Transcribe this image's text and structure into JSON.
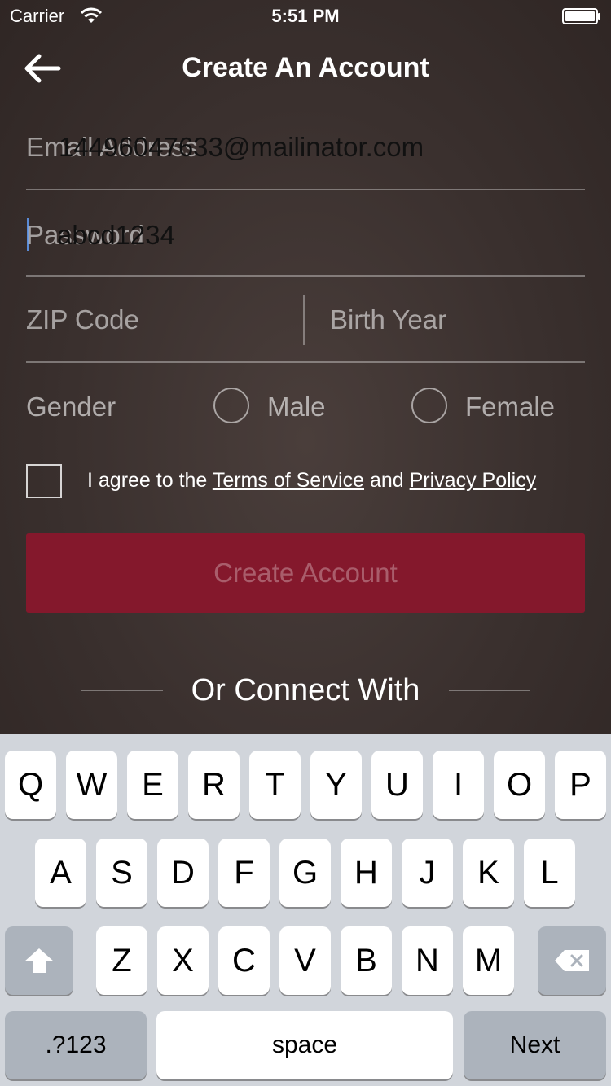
{
  "status_bar": {
    "carrier": "Carrier",
    "time": "5:51 PM"
  },
  "nav": {
    "title": "Create An Account"
  },
  "form": {
    "email": {
      "placeholder": "Email Address",
      "value": "14496047633@mailinator.com"
    },
    "password": {
      "placeholder": "Password",
      "value": "abcd1234"
    },
    "zip": {
      "placeholder": "ZIP Code"
    },
    "birth_year": {
      "placeholder": "Birth Year"
    },
    "gender": {
      "label": "Gender",
      "male": "Male",
      "female": "Female"
    },
    "agree": {
      "prefix": "I agree to the ",
      "terms": "Terms of Service",
      "and": " and ",
      "privacy": "Privacy Policy"
    },
    "submit": "Create Account"
  },
  "connect": {
    "text": "Or Connect With"
  },
  "keyboard": {
    "row1": [
      "Q",
      "W",
      "E",
      "R",
      "T",
      "Y",
      "U",
      "I",
      "O",
      "P"
    ],
    "row2": [
      "A",
      "S",
      "D",
      "F",
      "G",
      "H",
      "J",
      "K",
      "L"
    ],
    "row3": [
      "Z",
      "X",
      "C",
      "V",
      "B",
      "N",
      "M"
    ],
    "numbers": ".?123",
    "space": "space",
    "next": "Next"
  },
  "colors": {
    "accent": "#84182c",
    "background": "#3a2f2d",
    "keyboard": "#d1d5db"
  }
}
